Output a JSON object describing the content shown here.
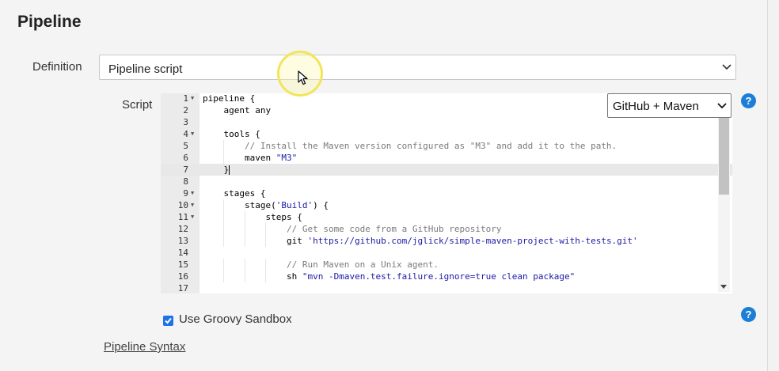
{
  "section": {
    "title": "Pipeline"
  },
  "definition": {
    "label": "Definition",
    "value": "Pipeline script"
  },
  "script": {
    "label": "Script",
    "sample_selector": {
      "value": "GitHub + Maven"
    },
    "lines": [
      {
        "num": "1",
        "text": "pipeline {",
        "fold": true
      },
      {
        "num": "2",
        "text": "    agent any"
      },
      {
        "num": "3",
        "text": ""
      },
      {
        "num": "4",
        "text": "    tools {",
        "fold": true
      },
      {
        "num": "5",
        "text": "        // Install the Maven version configured as \"M3\" and add it to the path."
      },
      {
        "num": "6",
        "text": "        maven \"M3\""
      },
      {
        "num": "7",
        "text": "    }",
        "active": true
      },
      {
        "num": "8",
        "text": ""
      },
      {
        "num": "9",
        "text": "    stages {",
        "fold": true
      },
      {
        "num": "10",
        "text": "        stage('Build') {",
        "fold": true
      },
      {
        "num": "11",
        "text": "            steps {",
        "fold": true
      },
      {
        "num": "12",
        "text": "                // Get some code from a GitHub repository"
      },
      {
        "num": "13",
        "text": "                git 'https://github.com/jglick/simple-maven-project-with-tests.git'"
      },
      {
        "num": "14",
        "text": ""
      },
      {
        "num": "15",
        "text": "                // Run Maven on a Unix agent."
      },
      {
        "num": "16",
        "text": "                sh \"mvn -Dmaven.test.failure.ignore=true clean package\""
      },
      {
        "num": "17",
        "text": ""
      }
    ]
  },
  "sandbox": {
    "label": "Use Groovy Sandbox",
    "checked": true
  },
  "syntax_link": {
    "label": "Pipeline Syntax"
  },
  "help": {
    "icon_text": "?"
  },
  "colors": {
    "accent": "#1c7ed6",
    "checkbox": "#1a73e8",
    "cursor_highlight": "#f2e55c"
  },
  "icons": [
    "help-icon",
    "chevron-down-icon",
    "check-icon",
    "mouse-pointer-icon",
    "fold-arrow-icon"
  ]
}
